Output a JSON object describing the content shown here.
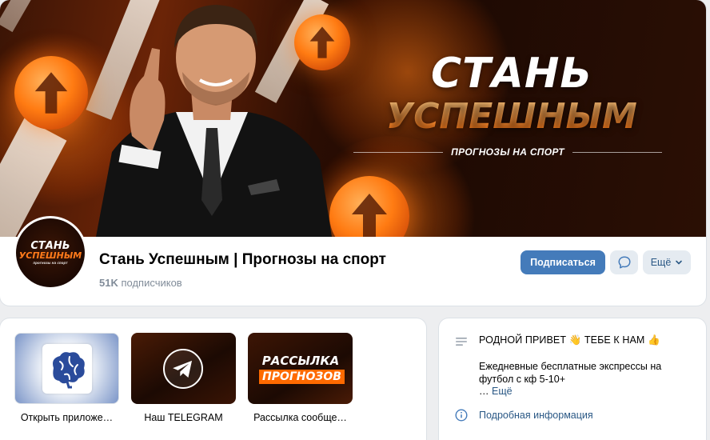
{
  "cover": {
    "headline_line1": "СТАНЬ",
    "headline_line2": "УСПЕШНЫМ",
    "subline": "ПРОГНОЗЫ НА СПОРТ"
  },
  "avatar": {
    "line1": "СТАНЬ",
    "line2": "УСПЕШНЫМ",
    "line3": "прогнозы на спорт"
  },
  "group": {
    "name": "Стань Успешным | Прогнозы на спорт",
    "subscribers_count": "51K",
    "subscribers_label": "подписчиков"
  },
  "actions": {
    "subscribe_label": "Подписаться",
    "more_label": "Ещё"
  },
  "apps": [
    {
      "label": "Открыть приложе…",
      "icon": "brain-icon"
    },
    {
      "label": "Наш TELEGRAM",
      "icon": "telegram-icon"
    },
    {
      "label": "Рассылка сообще…",
      "icon": "mail-banner",
      "banner_line1": "РАССЫЛКА",
      "banner_line2": "ПРОГНОЗОВ"
    }
  ],
  "info": {
    "status_text": "РОДНОЙ ПРИВЕТ 👋 ТЕБЕ К НАМ 👍",
    "description": "Ежедневные бесплатные экспрессы на футбол с кф 5-10+",
    "more_prefix": "… ",
    "more_link": "Ещё",
    "details_link": "Подробная информация"
  },
  "colors": {
    "accent": "#447bba",
    "link": "#2a5885",
    "muted": "#818c99",
    "brand_orange": "#ff6a00",
    "page_bg": "#edeef0"
  }
}
